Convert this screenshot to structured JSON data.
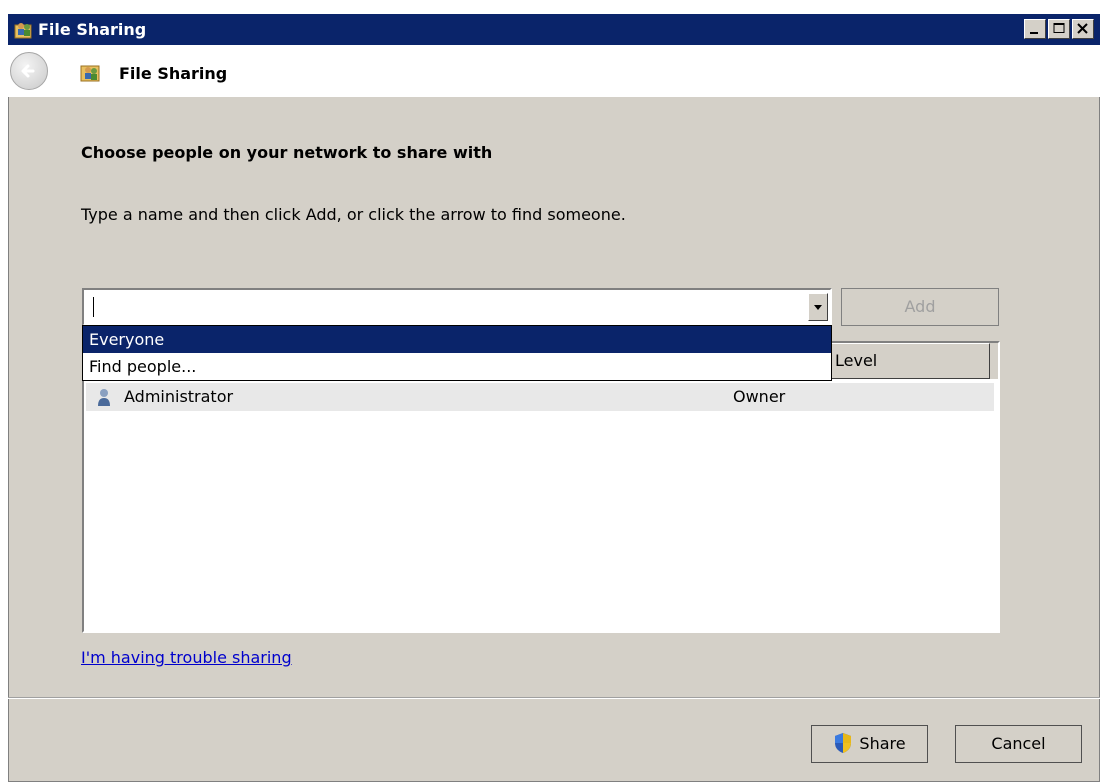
{
  "window": {
    "title": "File Sharing",
    "buttons": [
      "minimize",
      "maximize",
      "close"
    ]
  },
  "nav": {
    "title": "File Sharing",
    "back_icon": "back-arrow-icon",
    "title_icon": "users-icon"
  },
  "content": {
    "heading": "Choose people on your network to share with",
    "instruction": "Type a name and then click Add, or click the arrow to find someone.",
    "name_input": {
      "value": "",
      "placeholder": ""
    },
    "add_button": "Add",
    "dropdown_options": [
      {
        "label": "Everyone",
        "selected": true
      },
      {
        "label": "Find people...",
        "selected": false
      }
    ],
    "list": {
      "columns": [
        "",
        "Level"
      ],
      "rows": [
        {
          "name": "Administrator",
          "level": "Owner"
        }
      ]
    },
    "trouble_link": "I'm having trouble sharing"
  },
  "footer": {
    "share_button": "Share",
    "cancel_button": "Cancel"
  },
  "colors": {
    "titlebar": "#0a246a",
    "dialog_bg": "#d4d0c8",
    "link": "#0000cc",
    "selection": "#0a246a"
  }
}
